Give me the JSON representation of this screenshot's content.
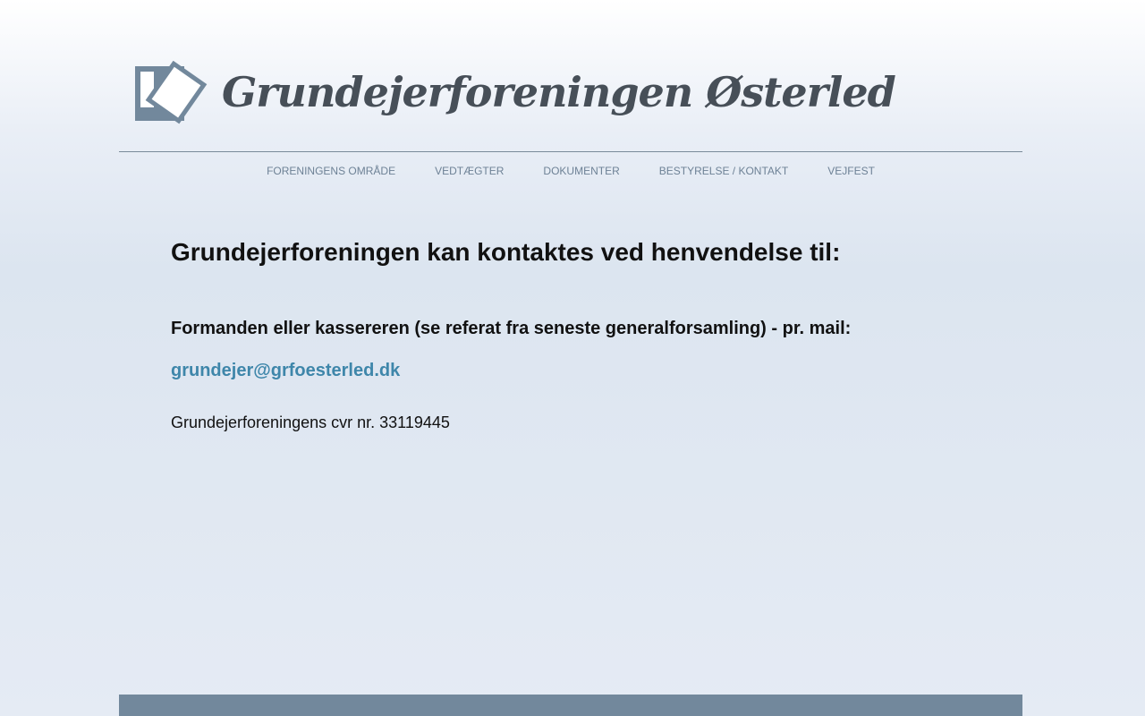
{
  "header": {
    "title": "Grundejerforeningen Østerled"
  },
  "nav": [
    "FORENINGENS OMRÅDE",
    "VEDTÆGTER",
    "DOKUMENTER",
    "BESTYRELSE / KONTAKT",
    "VEJFEST"
  ],
  "main": {
    "heading": "Grundejerforeningen kan kontaktes ved henvendelse til:",
    "subheading": "Formanden eller kassereren (se referat fra seneste generalforsamling) -  pr. mail:",
    "email": "grundejer@grfoesterled.dk",
    "cvr": "Grundejerforeningens cvr nr. 33119445"
  },
  "colors": {
    "accent": "#3e86aa",
    "footer": "#72889c"
  }
}
